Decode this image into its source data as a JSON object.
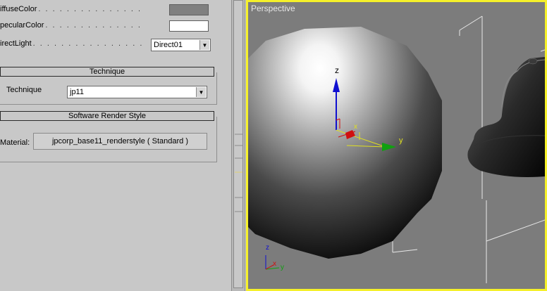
{
  "panel": {
    "params": [
      {
        "label": "iffuseColor",
        "type": "color",
        "value_color": "#808080"
      },
      {
        "label": "pecularColor",
        "type": "color",
        "value_color": "#ffffff"
      },
      {
        "label": "irectLight",
        "type": "dropdown",
        "value": "Direct01"
      }
    ],
    "dots": ". . . . . . . . . . . . . . . . . . . . . . . . .",
    "technique_section": {
      "title": "Technique",
      "label": "Technique",
      "value": "jp11"
    },
    "render_style_section": {
      "title": "Software Render Style",
      "label": "Material:",
      "button_label": "jpcorp_base11_renderstyle  ( Standard )"
    }
  },
  "viewport": {
    "label": "Perspective",
    "border_color": "#f5f02a",
    "background": "#7c7c7c",
    "gizmo": {
      "z": "z",
      "x": "x",
      "y": "y"
    },
    "corner_axes": {
      "z": "z",
      "x": "x",
      "y": "y"
    }
  }
}
